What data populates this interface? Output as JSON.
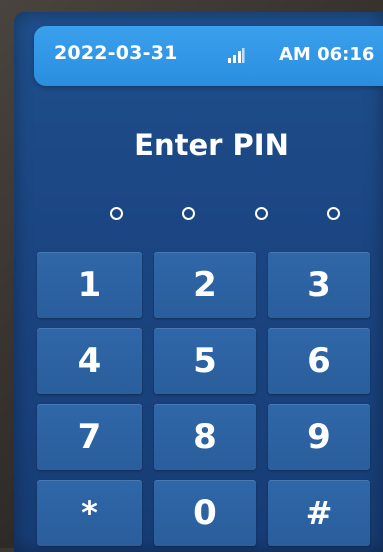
{
  "status_bar": {
    "date": "2022-03-31",
    "time": "AM 06:16",
    "signal_icon": "signal-icon"
  },
  "title": "Enter PIN",
  "pin": {
    "length": 4,
    "entered": 0
  },
  "keypad": {
    "keys": [
      "1",
      "2",
      "3",
      "4",
      "5",
      "6",
      "7",
      "8",
      "9",
      "*",
      "0",
      "#"
    ]
  },
  "colors": {
    "screen_bg": "#1b4683",
    "status_bar": "#2a8ee0",
    "key_bg": "#2a5e9c",
    "text": "#ffffff"
  }
}
